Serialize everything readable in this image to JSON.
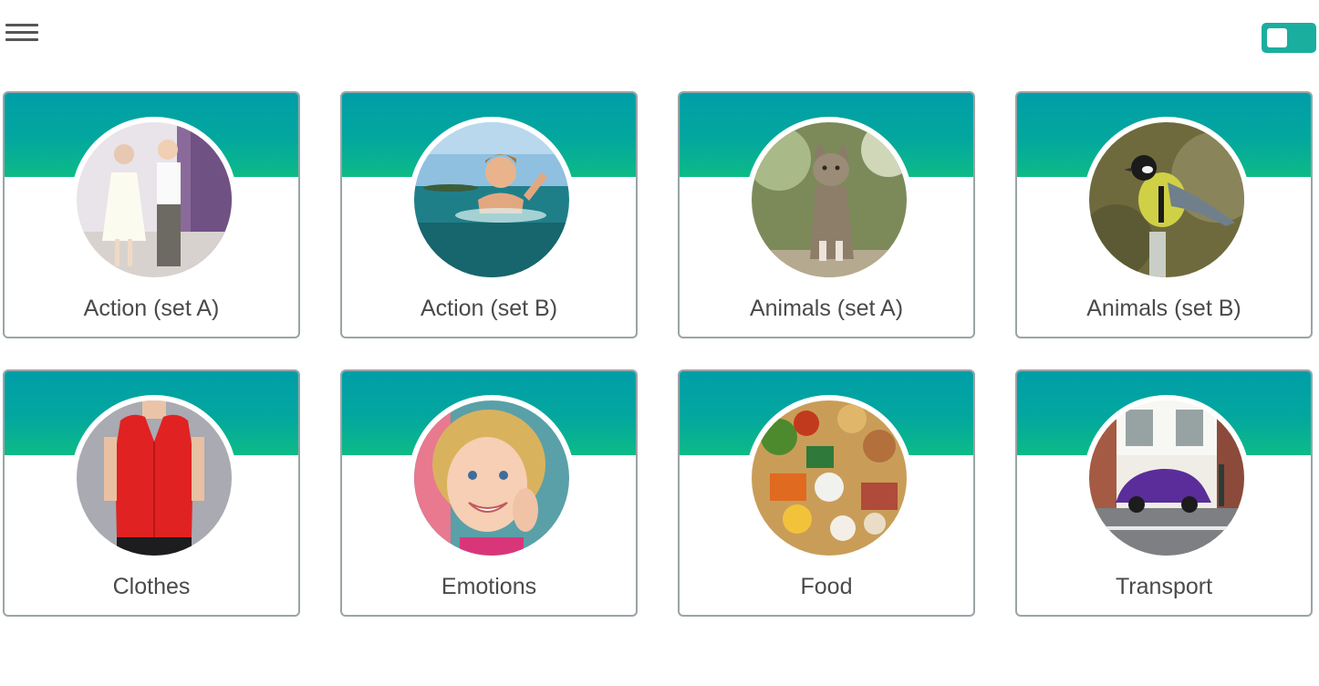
{
  "header": {
    "menu_icon": "hamburger-menu-icon",
    "toggle_icon": "toggle-switch-icon",
    "accent_color": "#1aae9f"
  },
  "categories": [
    {
      "label": "Action (set A)",
      "image": "children-dancing-photo"
    },
    {
      "label": "Action (set B)",
      "image": "child-swimming-photo"
    },
    {
      "label": "Animals (set A)",
      "image": "cat-sitting-photo"
    },
    {
      "label": "Animals (set B)",
      "image": "great-tit-bird-photo"
    },
    {
      "label": "Clothes",
      "image": "red-blouse-photo"
    },
    {
      "label": "Emotions",
      "image": "smiling-girl-photo"
    },
    {
      "label": "Food",
      "image": "assorted-food-photo"
    },
    {
      "label": "Transport",
      "image": "purple-car-photo"
    }
  ],
  "colors": {
    "card_band_top": "#009ea8",
    "card_band_bottom": "#0dbb86",
    "card_border": "#9aa4a6",
    "label_text": "#4a4a4a"
  }
}
